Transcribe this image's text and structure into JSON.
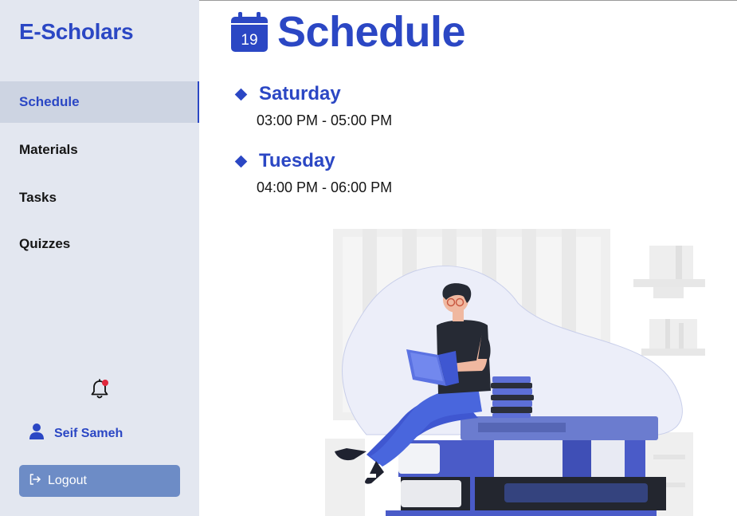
{
  "app": {
    "brand": "E-Scholars"
  },
  "sidebar": {
    "items": [
      {
        "label": "Schedule",
        "active": true
      },
      {
        "label": "Materials",
        "active": false
      },
      {
        "label": "Tasks",
        "active": false
      },
      {
        "label": "Quizzes",
        "active": false
      }
    ],
    "notification_icon": "bell-icon",
    "has_unread_notifications": true,
    "user": {
      "name": "Seif Sameh",
      "icon": "user-icon"
    },
    "logout": {
      "label": "Logout",
      "icon": "logout-icon"
    }
  },
  "main": {
    "title": "Schedule",
    "title_icon": "calendar-icon",
    "calendar_day": "19",
    "schedule": [
      {
        "day": "Saturday",
        "time": "03:00 PM - 05:00 PM"
      },
      {
        "day": "Tuesday",
        "time": "04:00 PM - 06:00 PM"
      }
    ]
  },
  "colors": {
    "accent": "#2b47c4",
    "sidebar_bg": "#e3e7f0",
    "active_item_bg": "#cdd4e2",
    "logout_bg": "#6d8cc6",
    "notification_dot": "#e0283c"
  }
}
